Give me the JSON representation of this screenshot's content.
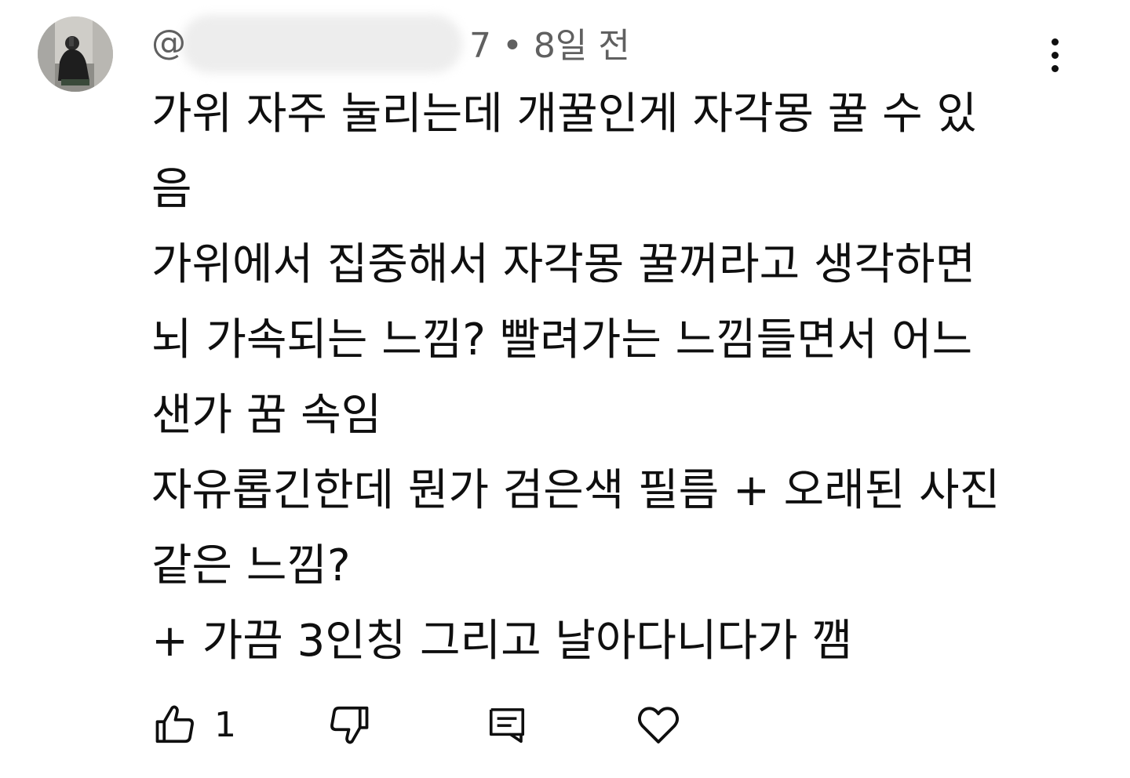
{
  "comment": {
    "author": {
      "handle_visible": "@",
      "avatar": "avatar-photo"
    },
    "timestamp": "7 • 8일 전",
    "lines": [
      "가위 자주 눌리는데 개꿀인게 자각몽 꿀 수 있",
      "음",
      "가위에서 집중해서 자각몽 꿀꺼라고 생각하면",
      "뇌 가속되는 느낌? 빨려가는 느낌들면서 어느",
      "샌가 꿈 속임",
      "자유롭긴한데 뭔가 검은색 필름 + 오래된 사진",
      "같은 느낌?",
      "+ 가끔 3인칭 그리고 날아다니다가 깸"
    ],
    "actions": {
      "like_count": "1",
      "like_icon": "thumbs-up-icon",
      "dislike_icon": "thumbs-down-icon",
      "reply_icon": "reply-icon",
      "heart_icon": "heart-icon",
      "more_icon": "more-vertical-icon"
    }
  },
  "colors": {
    "text": "#0f0f0f",
    "meta": "#606060",
    "background": "#ffffff"
  }
}
